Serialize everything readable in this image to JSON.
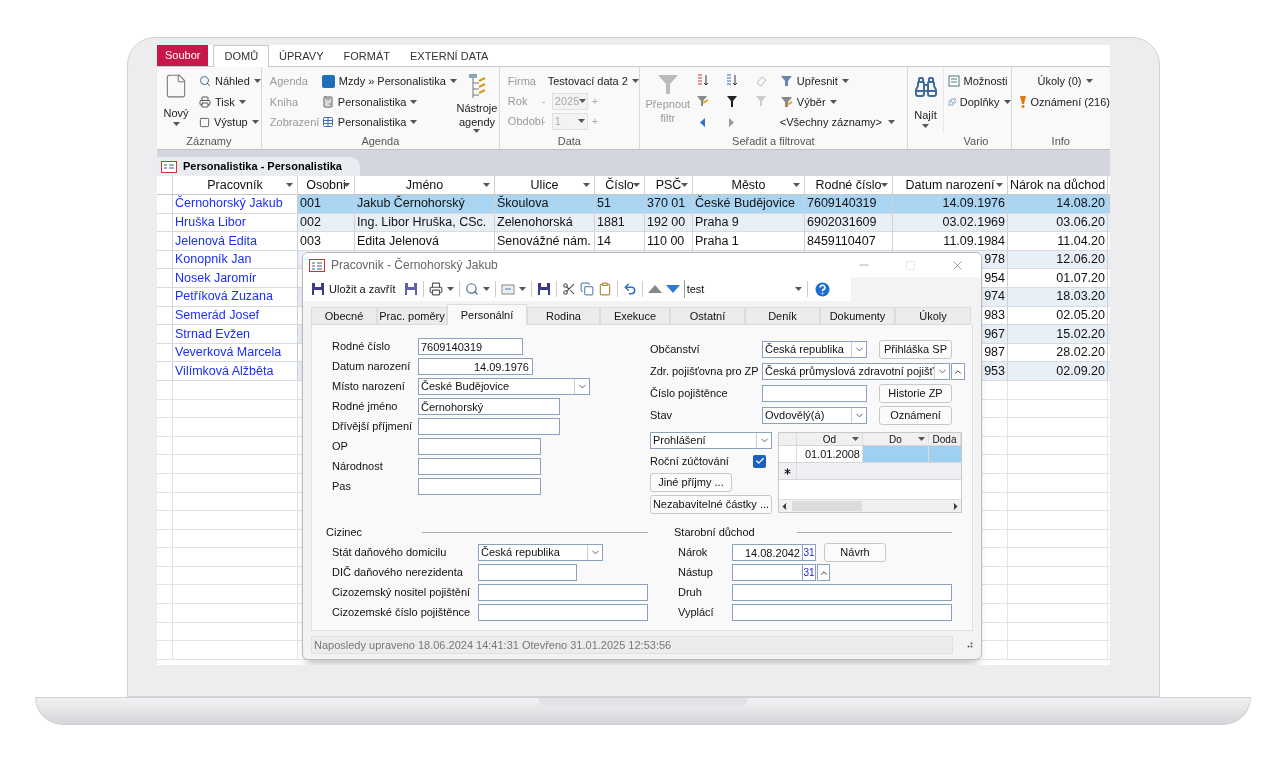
{
  "ribbon": {
    "tabs": [
      {
        "label": "Soubor",
        "kind": "file",
        "selected": false
      },
      {
        "label": "DOMŮ",
        "kind": "tab",
        "selected": true
      },
      {
        "label": "ÚPRAVY",
        "kind": "tab",
        "selected": false
      },
      {
        "label": "FORMÁT",
        "kind": "tab",
        "selected": false
      },
      {
        "label": "EXTERNÍ DATA",
        "kind": "tab",
        "selected": false
      }
    ],
    "records": {
      "new": "Nový",
      "items": [
        "Náhled",
        "Tisk",
        "Výstup"
      ],
      "label": "Záznamy"
    },
    "agenda": {
      "rows": [
        {
          "label": "Agenda",
          "value": "Mzdy » Personalistika"
        },
        {
          "label": "Kniha",
          "value": "Personalistika"
        },
        {
          "label": "Zobrazení",
          "value": "Personalistika"
        }
      ],
      "tools": "Nástroje agendy",
      "label": "Agenda"
    },
    "data": {
      "rows": [
        {
          "label": "Firma",
          "value": "Testovací data 2",
          "disabled": false
        },
        {
          "label": "Rok",
          "value": "2025",
          "disabled": true,
          "dec": "-",
          "inc": "+"
        },
        {
          "label": "Období",
          "value": "1",
          "disabled": true,
          "dec": "-",
          "inc": "+"
        }
      ],
      "label": "Data"
    },
    "filter": {
      "toggle": "Přepnout filtr",
      "refine": "Upřesnit",
      "selection": "Výběr",
      "records": "<Všechny záznamy>",
      "label": "Seřadit a filtrovat"
    },
    "find": "Najít",
    "vario": {
      "items": [
        "Možnosti",
        "Doplňky"
      ],
      "label": "Vario"
    },
    "info": {
      "tasks": "Úkoly (0)",
      "notices": "Oznámení (216)",
      "label": "Info"
    }
  },
  "document_tab": "Personalistika - Personalistika",
  "table": {
    "columns": [
      "Pracovník",
      "Osobni",
      "Jméno",
      "Ulice",
      "Číslo",
      "PSČ",
      "Město",
      "Rodné číslo",
      "Datum narození",
      "Nárok na důchod"
    ],
    "rows": [
      {
        "selected": true,
        "worker": "Černohorský Jakub",
        "personal_no": "001",
        "name": "Jakub Černohorský",
        "street": "Škoulova",
        "number": "51",
        "zip": "370 01",
        "city": "České Budějovice",
        "birth_no": "7609140319",
        "birth_date": "14.09.1976",
        "pension_claim": "14.08.20"
      },
      {
        "selected": false,
        "worker": "Hruška Libor",
        "personal_no": "002",
        "name": "Ing. Libor Hruška, CSc.",
        "street": "Zelenohorská",
        "number": "1881",
        "zip": "192 00",
        "city": "Praha 9",
        "birth_no": "6902031609",
        "birth_date": "03.02.1969",
        "pension_claim": "03.06.20"
      },
      {
        "selected": false,
        "worker": "Jelenová Edita",
        "personal_no": "003",
        "name": "Edita Jelenová",
        "street": "Senovážné nám.",
        "number": "14",
        "zip": "110 00",
        "city": "Praha 1",
        "birth_no": "8459110407",
        "birth_date": "11.09.1984",
        "pension_claim": "11.04.20"
      },
      {
        "selected": false,
        "worker": "Konopník Jan",
        "birth_date": "978",
        "pension_claim": "12.06.20"
      },
      {
        "selected": false,
        "worker": "Nosek Jaromír",
        "birth_date": "954",
        "pension_claim": "01.07.20"
      },
      {
        "selected": false,
        "worker": "Petříková Zuzana",
        "birth_date": "974",
        "pension_claim": "18.03.20"
      },
      {
        "selected": false,
        "worker": "Semerád Josef",
        "birth_date": "983",
        "pension_claim": "02.05.20"
      },
      {
        "selected": false,
        "worker": "Strnad Evžen",
        "birth_date": "967",
        "pension_claim": "15.02.20"
      },
      {
        "selected": false,
        "worker": "Veverková Marcela",
        "birth_date": "987",
        "pension_claim": "28.02.20"
      },
      {
        "selected": false,
        "worker": "Vilímková Alžběta",
        "birth_date": "953",
        "pension_claim": "02.09.20"
      }
    ]
  },
  "dialog": {
    "title": "Pracovnik - Černohorský Jakub",
    "save_close": "Uložit a zavřít",
    "filter_value": "test",
    "tabs": [
      {
        "label": "Obecné",
        "selected": false
      },
      {
        "label": "Prac. poměry",
        "selected": false
      },
      {
        "label": "Personální",
        "selected": true
      },
      {
        "label": "Rodina",
        "selected": false
      },
      {
        "label": "Exekuce",
        "selected": false
      },
      {
        "label": "Ostatní",
        "selected": false
      },
      {
        "label": "Deník",
        "selected": false
      },
      {
        "label": "Dokumenty",
        "selected": false
      },
      {
        "label": "Úkoly",
        "selected": false
      }
    ],
    "left_fields": [
      {
        "label": "Rodné číslo",
        "value": "7609140319",
        "kind": "text"
      },
      {
        "label": "Datum narození",
        "value": "14.09.1976",
        "kind": "date"
      },
      {
        "label": "Místo narození",
        "value": "České Budějovice",
        "kind": "combo"
      },
      {
        "label": "Rodné jméno",
        "value": "Černohorský",
        "kind": "text"
      },
      {
        "label": "Dřívější příjmení",
        "kind": "text"
      },
      {
        "label": "OP",
        "kind": "text"
      },
      {
        "label": "Národnost",
        "kind": "text"
      },
      {
        "label": "Pas",
        "kind": "text"
      }
    ],
    "right_fields": [
      {
        "label": "Občanství",
        "value": "Česká republika",
        "kind": "combo",
        "action": "Přihláška SP"
      },
      {
        "label": "Zdr. pojišťovna pro ZP",
        "value": "Česká průmyslová zdravotní pojišť",
        "kind": "combo"
      },
      {
        "label": "Číslo pojištěnce",
        "kind": "text",
        "action": "Historie ZP"
      },
      {
        "label": "Stav",
        "value": "Ovdovělý(á)",
        "kind": "combo",
        "action": "Oznámení"
      }
    ],
    "declaration": "Prohlášení",
    "annual_settlement": {
      "label": "Roční zúčtování",
      "checked": true
    },
    "buttons": [
      "Jiné příjmy ...",
      "Nezabavitelné částky ..."
    ],
    "subgrid": {
      "columns": [
        "Od",
        "Do",
        "Doda"
      ],
      "rows": [
        {
          "from": "01.01.2008",
          "selected": true
        }
      ]
    },
    "foreigner": {
      "title": "Cizinec",
      "fields": [
        {
          "label": "Stát daňového domicilu",
          "value": "Česká republika",
          "kind": "combo"
        },
        {
          "label": "DIČ daňového nerezidenta",
          "kind": "text"
        },
        {
          "label": "Cizozemský nositel pojištění",
          "kind": "text"
        },
        {
          "label": "Cizozemské číslo pojištěnce",
          "kind": "text"
        }
      ]
    },
    "pension": {
      "title": "Starobní důchod",
      "fields": [
        {
          "label": "Nárok",
          "value": "14.08.2042",
          "kind": "date_picker",
          "calendar": "31",
          "action": "Návrh"
        },
        {
          "label": "Nástup",
          "kind": "date_picker",
          "calendar": "31",
          "spin": true
        },
        {
          "label": "Druh",
          "kind": "text"
        },
        {
          "label": "Vyplácí",
          "kind": "text"
        }
      ]
    },
    "status": "Naposledy upraveno 18.06.2024 14:41:31 Otevřeno 31.01.2025 12:53:56"
  }
}
